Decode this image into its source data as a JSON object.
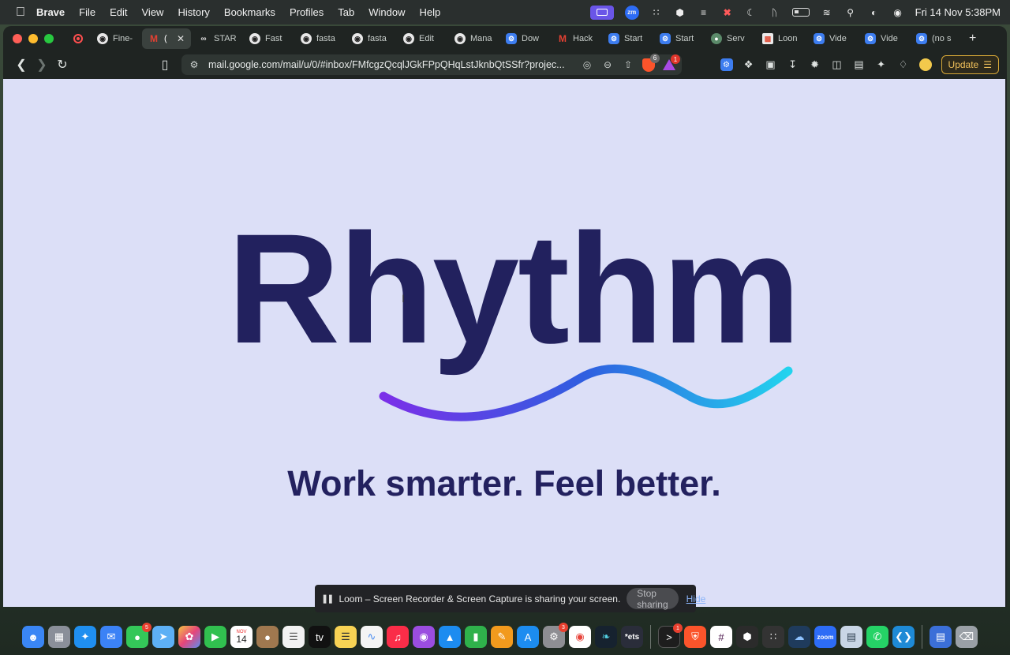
{
  "menubar": {
    "app_name": "Brave",
    "menus": [
      "File",
      "Edit",
      "View",
      "History",
      "Bookmarks",
      "Profiles",
      "Tab",
      "Window",
      "Help"
    ],
    "zoom_label": "zm",
    "clock": "Fri 14 Nov  5:38PM"
  },
  "tabs": [
    {
      "label": "Fine-",
      "icon": "github-icon"
    },
    {
      "label": "(",
      "icon": "gmail-icon",
      "active": true
    },
    {
      "label": "STAR",
      "icon": "glasses-icon"
    },
    {
      "label": "Fast",
      "icon": "github-icon"
    },
    {
      "label": "fasta",
      "icon": "github-icon"
    },
    {
      "label": "fasta",
      "icon": "github-icon"
    },
    {
      "label": "Edit",
      "icon": "github-icon"
    },
    {
      "label": "Mana",
      "icon": "github-icon"
    },
    {
      "label": "Dow",
      "icon": "gear-icon"
    },
    {
      "label": "Hack",
      "icon": "gmail-icon"
    },
    {
      "label": "Start",
      "icon": "gear-icon"
    },
    {
      "label": "Start",
      "icon": "gear-icon"
    },
    {
      "label": "Serv",
      "icon": "globe-icon"
    },
    {
      "label": "Loon",
      "icon": "loom-icon"
    },
    {
      "label": "Vide",
      "icon": "gear-icon"
    },
    {
      "label": "Vide",
      "icon": "gear-icon"
    },
    {
      "label": "(no s",
      "icon": "gear-icon"
    }
  ],
  "toolbar": {
    "url": "mail.google.com/mail/u/0/#inbox/FMfcgzQcqlJGkFPpQHqLstJknbQtSSfr?projec...",
    "shield_badge": "6",
    "rewards_badge": "1",
    "update_label": "Update"
  },
  "page": {
    "brand": "Rhythm",
    "tagline": "Work smarter. Feel better.",
    "wave_colors": [
      "#7b2fe8",
      "#2f5fe0",
      "#22d3ee"
    ]
  },
  "share_notice": {
    "message": "Loom – Screen Recorder & Screen Capture is sharing your screen.",
    "stop_label": "Stop sharing",
    "hide_label": "Hide"
  },
  "dock": {
    "calendar_month": "NOV",
    "calendar_day": "14",
    "messages_badge": "5",
    "settings_badge": "3",
    "terminal_badge": "1",
    "tv_label": "tv",
    "ets_label": "*ets",
    "zoom_label": "zoom"
  }
}
